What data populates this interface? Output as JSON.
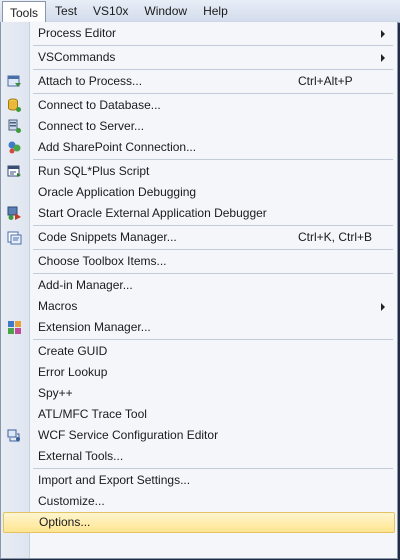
{
  "menubar": {
    "items": [
      {
        "label": "Tools"
      },
      {
        "label": "Test"
      },
      {
        "label": "VS10x"
      },
      {
        "label": "Window"
      },
      {
        "label": "Help"
      }
    ]
  },
  "tools_menu": {
    "process_editor": "Process Editor",
    "vscommands": "VSCommands",
    "attach_to_process": "Attach to Process...",
    "attach_to_process_shortcut": "Ctrl+Alt+P",
    "connect_to_database": "Connect to Database...",
    "connect_to_server": "Connect to Server...",
    "add_sharepoint_connection": "Add SharePoint Connection...",
    "run_sqlplus_script": "Run SQL*Plus Script",
    "oracle_app_debugging": "Oracle Application Debugging",
    "start_oracle_debugger": "Start Oracle External Application Debugger",
    "code_snippets_manager": "Code Snippets Manager...",
    "code_snippets_manager_shortcut": "Ctrl+K, Ctrl+B",
    "choose_toolbox_items": "Choose Toolbox Items...",
    "addin_manager": "Add-in Manager...",
    "macros": "Macros",
    "extension_manager": "Extension Manager...",
    "create_guid": "Create GUID",
    "error_lookup": "Error Lookup",
    "spy": "Spy++",
    "atl_mfc_trace_tool": "ATL/MFC Trace Tool",
    "wcf_service_config_editor": "WCF Service Configuration Editor",
    "external_tools": "External Tools...",
    "import_export_settings": "Import and Export Settings...",
    "customize": "Customize...",
    "options": "Options..."
  },
  "colors": {
    "highlight": "#ffe58f",
    "menu_background": "#f4f6fa",
    "gutter": "#e3e8f1"
  }
}
